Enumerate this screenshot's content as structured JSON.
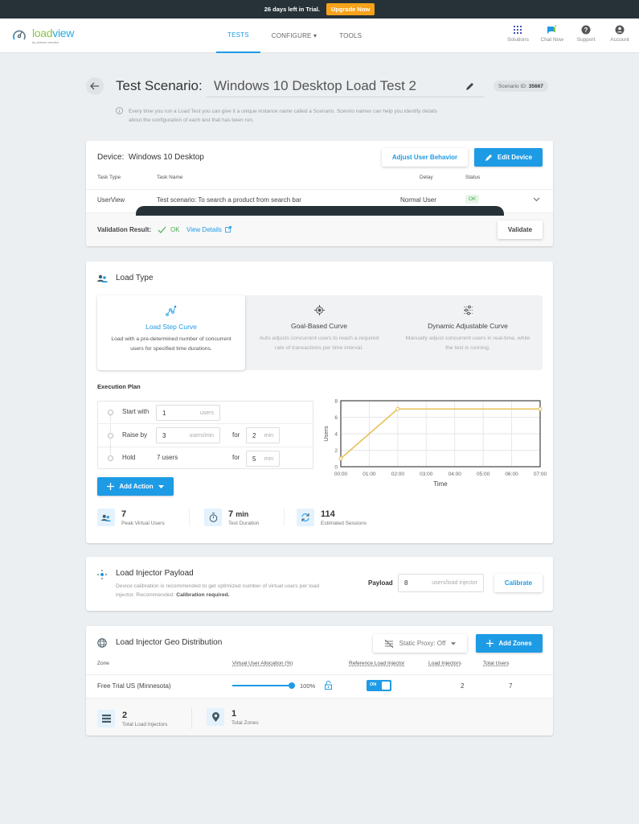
{
  "trial_banner": {
    "text": "26 days left in Trial.",
    "upgrade_label": "Upgrade Now"
  },
  "nav": {
    "logo_text_a": "load",
    "logo_text_b": "view",
    "logo_sub": "by dotcom-monitor",
    "tabs": [
      {
        "label": "TESTS",
        "active": true
      },
      {
        "label": "CONFIGURE ▾"
      },
      {
        "label": "TOOLS"
      }
    ],
    "right": [
      {
        "label": "Solutions",
        "icon": "grid-icon"
      },
      {
        "label": "Chat Now",
        "icon": "chat-icon"
      },
      {
        "label": "Support",
        "icon": "help-icon"
      },
      {
        "label": "Account",
        "icon": "account-icon"
      }
    ]
  },
  "scenario": {
    "label": "Test Scenario:",
    "name": "Windows 10 Desktop Load Test 2",
    "id_label": "Scenario ID:",
    "id_value": "35667",
    "info": "Every time you run a Load Test you can give it a unique instance name called a Scenario. Scenrio names can help you identify details about the configuration of each test that has been run."
  },
  "device": {
    "label": "Device:",
    "name": "Windows 10 Desktop",
    "adjust_label": "Adjust User Behavior",
    "edit_label": "Edit Device",
    "columns": [
      "Task Type",
      "Task Name",
      "Delay",
      "Status"
    ],
    "rows": [
      {
        "type": "UserView",
        "name": "Test scenario: To search a product from search bar",
        "delay": "Normal User",
        "status": "OK"
      }
    ],
    "validation_label": "Validation Result:",
    "validation_status": "OK",
    "view_details": "View Details",
    "validate_label": "Validate"
  },
  "load_type": {
    "title": "Load Type",
    "options": [
      {
        "title": "Load Step Curve",
        "desc": "Load with a pre-determined number of concurrent users for specified time durations.",
        "selected": true
      },
      {
        "title": "Goal-Based Curve",
        "desc": "Auto adjusts concurrent users to reach a required rate of transactions per time interval."
      },
      {
        "title": "Dynamic Adjustable Curve",
        "desc": "Manually adjust concurrent users in real-time, while the test is running."
      }
    ],
    "plan_title": "Execution Plan",
    "plan": {
      "start_label": "Start with",
      "start_value": "1",
      "start_unit": "users",
      "raise_label": "Raise by",
      "raise_value": "3",
      "raise_unit": "users/min",
      "raise_for": "for",
      "raise_dur": "2",
      "raise_dur_unit": "min",
      "hold_label": "Hold",
      "hold_value": "7 users",
      "hold_for": "for",
      "hold_dur": "5",
      "hold_dur_unit": "min"
    },
    "add_action": "Add Action",
    "stats": [
      {
        "value": "7",
        "unit": "",
        "label": "Peak Virtual Users"
      },
      {
        "value": "7",
        "unit": "min",
        "label": "Test Duration"
      },
      {
        "value": "114",
        "unit": "",
        "label": "Estimated Sessions"
      }
    ]
  },
  "chart_data": {
    "type": "line",
    "x": [
      "00:00",
      "02:00",
      "07:00"
    ],
    "x_minutes": [
      0,
      2,
      7
    ],
    "values": [
      1,
      7,
      7
    ],
    "xticks": [
      "00:00",
      "01:00",
      "02:00",
      "03:00",
      "04:00",
      "05:00",
      "06:00",
      "07:00"
    ],
    "yticks": [
      0,
      2,
      4,
      6,
      8
    ],
    "xlabel": "Time",
    "ylabel": "Users",
    "ylim": [
      0,
      8
    ],
    "xlim": [
      0,
      7
    ],
    "grid": true,
    "color": "#e8c15a"
  },
  "payload": {
    "title": "Load Injector Payload",
    "desc_a": "Device calibration is recommended to get optimized number of virtual users per load injector. Recommended:",
    "desc_b": "Calibration required.",
    "label": "Payload",
    "value": "8",
    "unit": "users/load injector",
    "calibrate": "Calibrate"
  },
  "geo": {
    "title": "Load Injector Geo Distribution",
    "proxy_label": "Static Proxy: Off",
    "add_zones": "Add Zones",
    "columns": [
      "Zone",
      "Virtual User Allocation (%)",
      "Reference Load Injector",
      "Load Injectors",
      "Total Users"
    ],
    "rows": [
      {
        "zone": "Free Trial US (Minnesota)",
        "allocation": "100%",
        "allocation_value": 100,
        "reference": "ON",
        "injectors": "2",
        "users": "7"
      }
    ],
    "stats": [
      {
        "value": "2",
        "label": "Total Load Injectors"
      },
      {
        "value": "1",
        "label": "Total Zones"
      }
    ]
  },
  "colors": {
    "accent": "#1e9be5",
    "success": "#4caf50",
    "upgrade": "#f7a21b",
    "logo_green": "#8bc34a"
  }
}
